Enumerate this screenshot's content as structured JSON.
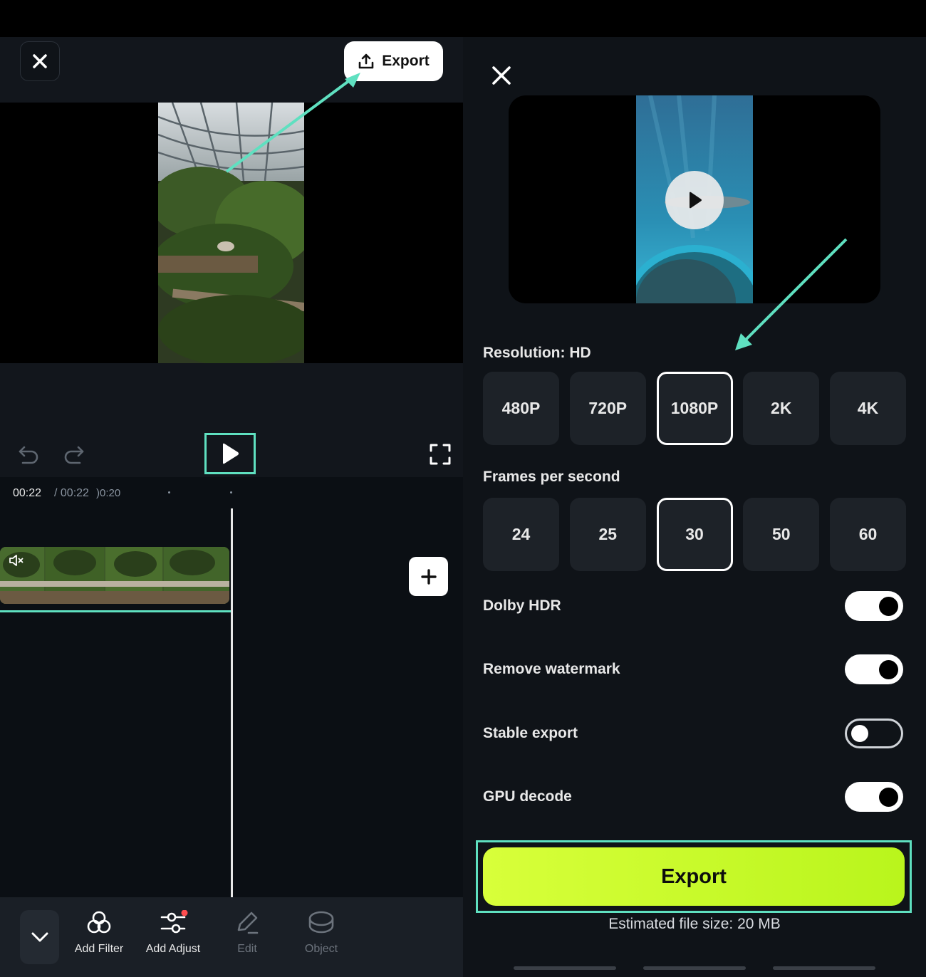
{
  "left": {
    "export_label": "Export",
    "time_current": "00:22",
    "time_separator": " / 00:22",
    "time_tick": ")0:20",
    "tools": [
      {
        "label": "Add Filter",
        "icon": "filter-icon"
      },
      {
        "label": "Add Adjust",
        "icon": "adjust-icon"
      },
      {
        "label": "Edit",
        "icon": "edit-icon"
      },
      {
        "label": "Object",
        "icon": "object-icon"
      }
    ]
  },
  "right": {
    "resolution_label": "Resolution: HD",
    "resolutions": [
      "480P",
      "720P",
      "1080P",
      "2K",
      "4K"
    ],
    "resolution_selected": "1080P",
    "fps_label": "Frames per second",
    "fps": [
      "24",
      "25",
      "30",
      "50",
      "60"
    ],
    "fps_selected": "30",
    "toggles": [
      {
        "label": "Dolby HDR",
        "on": true
      },
      {
        "label": "Remove watermark",
        "on": true
      },
      {
        "label": "Stable export",
        "on": false
      },
      {
        "label": "GPU decode",
        "on": true
      }
    ],
    "export_label": "Export",
    "file_size": "Estimated file size: 20 MB"
  },
  "colors": {
    "accent_teal": "#5fe0c0",
    "export_green": "#c6fa2a",
    "panel_bg": "#0f1318"
  }
}
